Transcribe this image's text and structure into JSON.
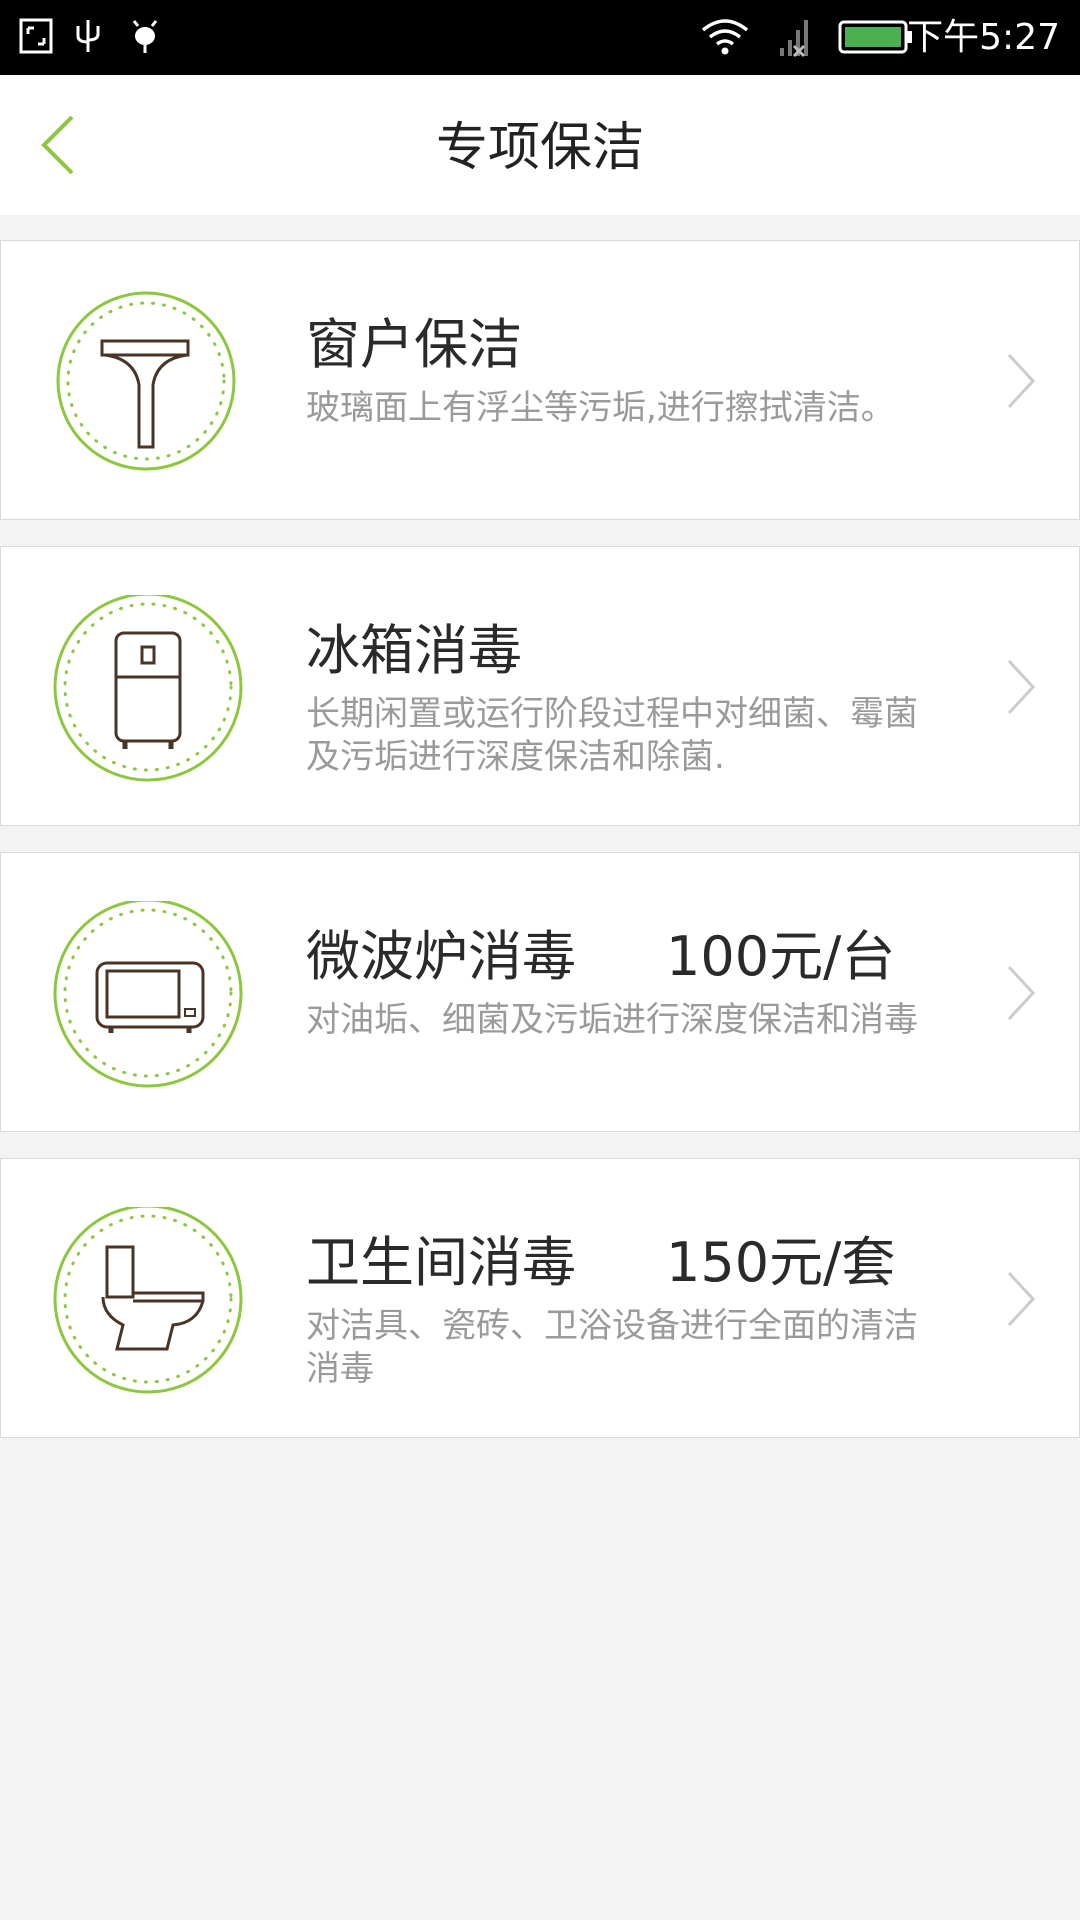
{
  "status_bar": {
    "time": "下午5:27",
    "icons": [
      "screenshot-icon",
      "usb-icon",
      "android-debug-icon",
      "wifi-icon",
      "signal-icon",
      "battery-icon"
    ]
  },
  "header": {
    "title": "专项保洁",
    "back_icon": "chevron-left-icon"
  },
  "colors": {
    "accent": "#8dc63f",
    "icon_stroke": "#4a3426",
    "title_text": "#2a2a2a",
    "desc_text": "#9a9a9a"
  },
  "items": [
    {
      "icon": "window-squeegee-icon",
      "title": "窗户保洁",
      "price": "",
      "desc": "玻璃面上有浮尘等污垢,进行擦拭清洁。"
    },
    {
      "icon": "refrigerator-icon",
      "title": "冰箱消毒",
      "price": "",
      "desc": "长期闲置或运行阶段过程中对细菌、霉菌及污垢进行深度保洁和除菌."
    },
    {
      "icon": "microwave-icon",
      "title": "微波炉消毒",
      "price": "100元/台",
      "desc": "对油垢、细菌及污垢进行深度保洁和消毒"
    },
    {
      "icon": "toilet-icon",
      "title": "卫生间消毒",
      "price": "150元/套",
      "desc": "对洁具、瓷砖、卫浴设备进行全面的清洁消毒"
    }
  ]
}
